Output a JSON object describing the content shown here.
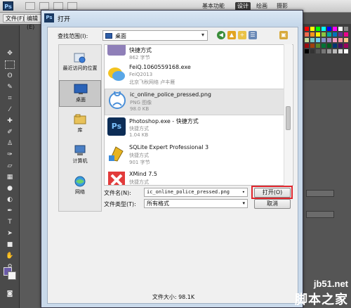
{
  "photoshop": {
    "logo": "Ps",
    "workspaces": [
      "基本功能",
      "设计",
      "绘画",
      "摄影"
    ],
    "active_workspace": "设计",
    "menu": [
      "文件(F)",
      "编辑(E)"
    ]
  },
  "dialog": {
    "title": "打开",
    "look_in_label": "查找范围(I):",
    "look_in_value": "桌面",
    "places": [
      {
        "label": "最近访问的位置",
        "icon": "recent-places-icon"
      },
      {
        "label": "桌面",
        "icon": "desktop-icon",
        "selected": true
      },
      {
        "label": "库",
        "icon": "libraries-icon"
      },
      {
        "label": "计算机",
        "icon": "computer-icon"
      },
      {
        "label": "网络",
        "icon": "network-icon"
      }
    ],
    "files": [
      {
        "name": "快捷方式",
        "sub1": "862 字节",
        "sub2": "",
        "icon": "shortcut-icon"
      },
      {
        "name": "FeiQ.1060559168.exe",
        "sub1": "FeiQ2013",
        "sub2": "北京飞秋网络 卢丰雁",
        "icon": "feiq-icon"
      },
      {
        "name": "ic_online_police_pressed.png",
        "sub1": "PNG 图像",
        "sub2": "98.0 KB",
        "icon": "png-file-icon"
      },
      {
        "name": "Photoshop.exe - 快捷方式",
        "sub1": "快捷方式",
        "sub2": "1.04 KB",
        "icon": "photoshop-icon"
      },
      {
        "name": "SQLite Expert Professional 3",
        "sub1": "快捷方式",
        "sub2": "901 字节",
        "icon": "sqlite-icon"
      },
      {
        "name": "XMind 7.5",
        "sub1": "快捷方式",
        "sub2": "",
        "icon": "xmind-icon"
      }
    ],
    "filename_label": "文件名(N):",
    "filename_value": "ic_online_police_pressed.png",
    "filetype_label": "文件类型(T):",
    "filetype_value": "所有格式",
    "open_button": "打开(O)",
    "cancel_button": "取消",
    "filesize_text": "文件大小: 98.1K"
  },
  "watermark": {
    "line1": "jb51.net",
    "line2": "脚本之家"
  },
  "colors": {
    "highlight_ring": "#e0262d",
    "dialog_frame": "#c9d9ea"
  }
}
